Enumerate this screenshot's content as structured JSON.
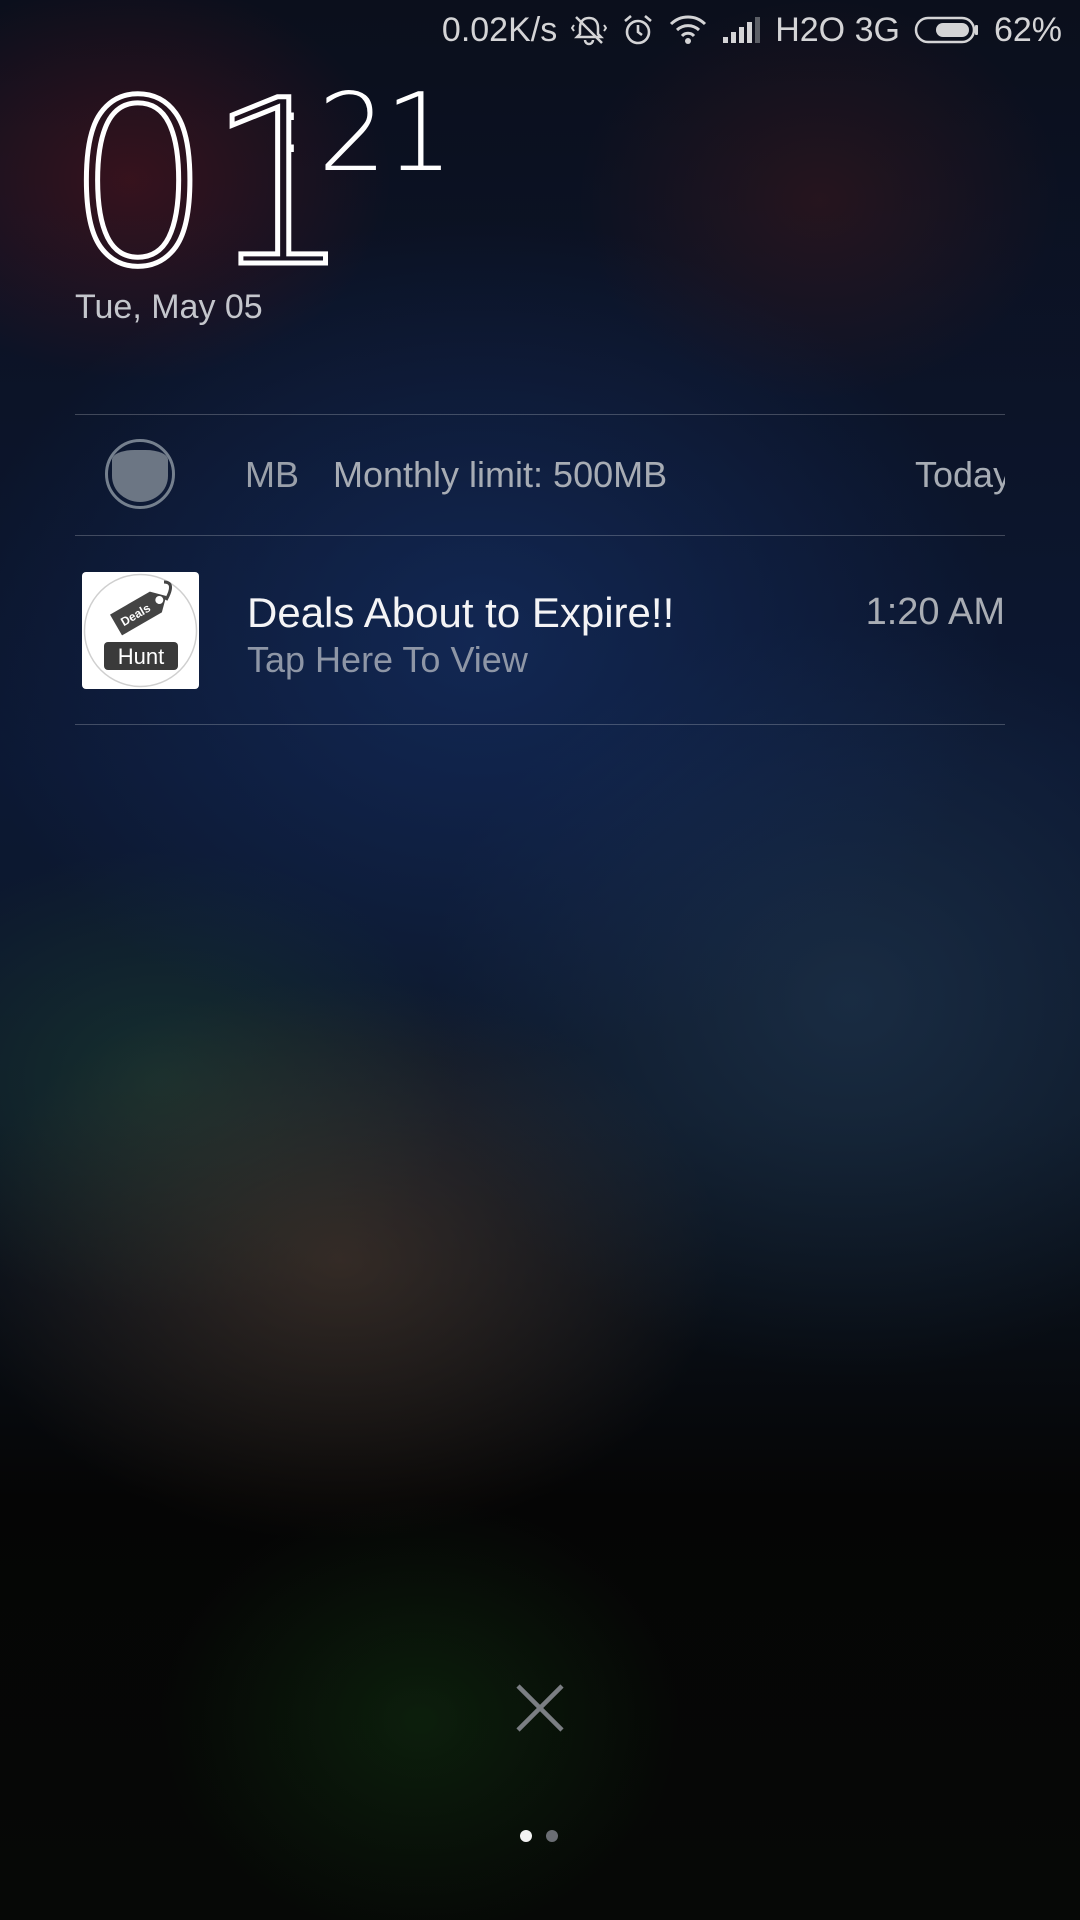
{
  "status_bar": {
    "net_speed": "0.02K/s",
    "carrier": "H2O 3G",
    "battery_percent": "62%",
    "battery_level": 0.62,
    "icons": [
      "vibrate-icon",
      "alarm-icon",
      "wifi-icon",
      "signal-icon",
      "battery-icon"
    ]
  },
  "clock": {
    "hours": "01",
    "minutes": "21",
    "colon": ":",
    "date": "Tue, May 05"
  },
  "notifications": [
    {
      "app_icon": "data-usage-icon",
      "partial_text": "MB",
      "text": "Monthly limit: 500MB",
      "time": "Today"
    },
    {
      "app_icon": "deals-hunt-icon",
      "icon_text": "Hunt",
      "icon_tag_text": "Deals",
      "title": "Deals About to Expire!!",
      "subtitle": "Tap Here To View",
      "time": "1:20 AM"
    }
  ],
  "pager": {
    "current": 1,
    "total": 2
  },
  "colors": {
    "accent_text": "#ffffff",
    "muted_text": "#8e96a6",
    "divider": "#3a3f4c"
  }
}
